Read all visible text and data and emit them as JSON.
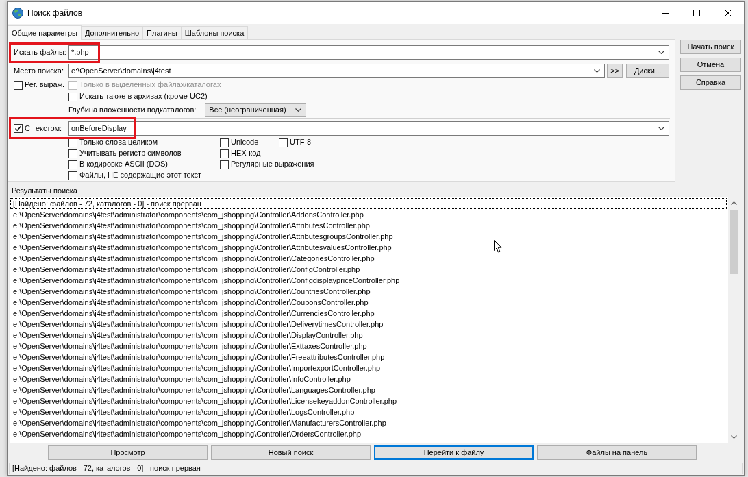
{
  "window": {
    "title": "Поиск файлов"
  },
  "tabs": [
    {
      "label": "Общие параметры",
      "selected": true
    },
    {
      "label": "Дополнительно",
      "selected": false
    },
    {
      "label": "Плагины",
      "selected": false
    },
    {
      "label": "Шаблоны поиска",
      "selected": false
    }
  ],
  "search_panel": {
    "file_mask": {
      "label": "Искать файлы:",
      "value": "*.php",
      "highlighted": true
    },
    "location": {
      "label": "Место поиска:",
      "value": "e:\\OpenServer\\domains\\j4test",
      "buttons": [
        ">>",
        "Диски..."
      ]
    },
    "regex": {
      "label": "Рег. выраж.",
      "checked": false
    },
    "options": [
      {
        "label": "Только в выделенных файлах/каталогах",
        "checked": false,
        "disabled": true
      },
      {
        "label": "Искать также в архивах (кроме UC2)",
        "checked": false,
        "disabled": false
      }
    ],
    "depth": {
      "label": "Глубина вложенности подкаталогов:",
      "value": "Все (неограниченная)"
    },
    "text_search": {
      "label": "С текстом:",
      "checked": true,
      "value": "onBeforeDisplay",
      "highlighted": true
    },
    "text_option_columns": [
      {
        "items": [
          {
            "label": "Только слова целиком",
            "checked": false
          },
          {
            "label": "Учитывать регистр символов",
            "checked": false
          },
          {
            "label": "В кодировке ASCII (DOS)",
            "checked": false
          },
          {
            "label": "Файлы, НЕ содержащие этот текст",
            "checked": false
          }
        ]
      },
      {
        "items": [
          {
            "label": "Unicode",
            "checked": false
          },
          {
            "label": "HEX-код",
            "checked": false
          },
          {
            "label": "Регулярные выражения",
            "checked": false
          }
        ]
      },
      {
        "items": [
          {
            "label": "UTF-8",
            "checked": false
          }
        ]
      }
    ]
  },
  "side_buttons": [
    "Начать поиск",
    "Отмена",
    "Справка"
  ],
  "results": {
    "title": "Результаты поиска",
    "rows": [
      {
        "text": "[Найдено: файлов - 72, каталогов - 0] - поиск прерван",
        "focused": true
      },
      {
        "text": "e:\\OpenServer\\domains\\j4test\\administrator\\components\\com_jshopping\\Controller\\AddonsController.php",
        "focused": false
      },
      {
        "text": "e:\\OpenServer\\domains\\j4test\\administrator\\components\\com_jshopping\\Controller\\AttributesController.php",
        "focused": false
      },
      {
        "text": "e:\\OpenServer\\domains\\j4test\\administrator\\components\\com_jshopping\\Controller\\AttributesgroupsController.php",
        "focused": false
      },
      {
        "text": "e:\\OpenServer\\domains\\j4test\\administrator\\components\\com_jshopping\\Controller\\AttributesvaluesController.php",
        "focused": false
      },
      {
        "text": "e:\\OpenServer\\domains\\j4test\\administrator\\components\\com_jshopping\\Controller\\CategoriesController.php",
        "focused": false
      },
      {
        "text": "e:\\OpenServer\\domains\\j4test\\administrator\\components\\com_jshopping\\Controller\\ConfigController.php",
        "focused": false
      },
      {
        "text": "e:\\OpenServer\\domains\\j4test\\administrator\\components\\com_jshopping\\Controller\\ConfigdisplaypriceController.php",
        "focused": false
      },
      {
        "text": "e:\\OpenServer\\domains\\j4test\\administrator\\components\\com_jshopping\\Controller\\CountriesController.php",
        "focused": false
      },
      {
        "text": "e:\\OpenServer\\domains\\j4test\\administrator\\components\\com_jshopping\\Controller\\CouponsController.php",
        "focused": false
      },
      {
        "text": "e:\\OpenServer\\domains\\j4test\\administrator\\components\\com_jshopping\\Controller\\CurrenciesController.php",
        "focused": false
      },
      {
        "text": "e:\\OpenServer\\domains\\j4test\\administrator\\components\\com_jshopping\\Controller\\DeliverytimesController.php",
        "focused": false
      },
      {
        "text": "e:\\OpenServer\\domains\\j4test\\administrator\\components\\com_jshopping\\Controller\\DisplayController.php",
        "focused": false
      },
      {
        "text": "e:\\OpenServer\\domains\\j4test\\administrator\\components\\com_jshopping\\Controller\\ExttaxesController.php",
        "focused": false
      },
      {
        "text": "e:\\OpenServer\\domains\\j4test\\administrator\\components\\com_jshopping\\Controller\\FreeattributesController.php",
        "focused": false
      },
      {
        "text": "e:\\OpenServer\\domains\\j4test\\administrator\\components\\com_jshopping\\Controller\\ImportexportController.php",
        "focused": false
      },
      {
        "text": "e:\\OpenServer\\domains\\j4test\\administrator\\components\\com_jshopping\\Controller\\InfoController.php",
        "focused": false
      },
      {
        "text": "e:\\OpenServer\\domains\\j4test\\administrator\\components\\com_jshopping\\Controller\\LanguagesController.php",
        "focused": false
      },
      {
        "text": "e:\\OpenServer\\domains\\j4test\\administrator\\components\\com_jshopping\\Controller\\LicensekeyaddonController.php",
        "focused": false
      },
      {
        "text": "e:\\OpenServer\\domains\\j4test\\administrator\\components\\com_jshopping\\Controller\\LogsController.php",
        "focused": false
      },
      {
        "text": "e:\\OpenServer\\domains\\j4test\\administrator\\components\\com_jshopping\\Controller\\ManufacturersController.php",
        "focused": false
      },
      {
        "text": "e:\\OpenServer\\domains\\j4test\\administrator\\components\\com_jshopping\\Controller\\OrdersController.php",
        "focused": false
      }
    ]
  },
  "bottom_buttons": [
    {
      "label": "Просмотр",
      "default": false
    },
    {
      "label": "Новый поиск",
      "default": false
    },
    {
      "label": "Перейти к файлу",
      "default": true
    },
    {
      "label": "Файлы на панель",
      "default": false
    }
  ],
  "status_bar": {
    "text": "[Найдено: файлов - 72, каталогов - 0] - поиск прерван"
  }
}
